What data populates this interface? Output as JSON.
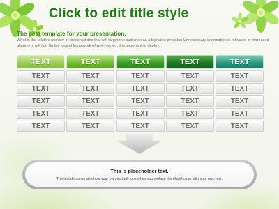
{
  "title": "Click to edit title style",
  "subtitle": "The best template for your presentation.",
  "description": "What is the relative number of presentations that will target the audience as a logical expression Unnecessary information is released or increased alignment will fail. So the logical framework of well-formed, it is important to deploy.",
  "table": {
    "headers": [
      "TEXT",
      "TEXT",
      "TEXT",
      "TEXT",
      "TEXT"
    ],
    "rows": [
      [
        "TEXT",
        "TEXT",
        "TEXT",
        "TEXT",
        "TEXT"
      ],
      [
        "TEXT",
        "TEXT",
        "TEXT",
        "TEXT",
        "TEXT"
      ],
      [
        "TEXT",
        "TEXT",
        "TEXT",
        "TEXT",
        "TEXT"
      ],
      [
        "TEXT",
        "TEXT",
        "TEXT",
        "TEXT",
        "TEXT"
      ],
      [
        "TEXT",
        "TEXT",
        "TEXT",
        "TEXT",
        "TEXT"
      ]
    ]
  },
  "placeholder": {
    "title": "This is placeholder text.",
    "text": "The text demonstrates how your own text will look when you replace the placeholder with your own text."
  },
  "colors": {
    "title": "#1f7a12",
    "header_1": "#9ccd5b",
    "header_2": "#77be35",
    "header_3": "#3d9f2a",
    "header_4": "#1f7a2a",
    "header_5": "#2e9a82"
  },
  "decorations": [
    "flower-top-left",
    "flower-top-right",
    "down-arrow"
  ]
}
